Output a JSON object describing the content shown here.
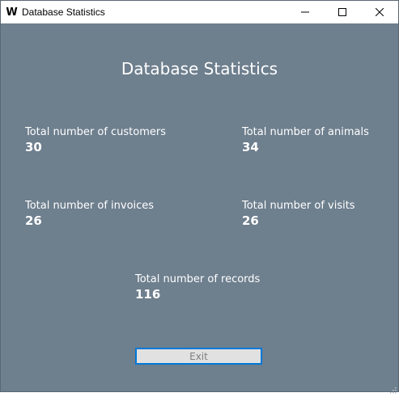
{
  "window": {
    "title": "Database Statistics",
    "app_icon_letter": "W",
    "icons": {
      "minimize": "minimize-icon",
      "maximize": "maximize-icon",
      "close": "close-icon"
    }
  },
  "main": {
    "heading": "Database Statistics",
    "stats": {
      "customers": {
        "label": "Total number of customers",
        "value": "30"
      },
      "animals": {
        "label": "Total number of animals",
        "value": "34"
      },
      "invoices": {
        "label": "Total number of invoices",
        "value": "26"
      },
      "visits": {
        "label": "Total number of visits",
        "value": "26"
      },
      "records": {
        "label": "Total number of records",
        "value": "116"
      }
    },
    "exit_label": "Exit"
  },
  "colors": {
    "background": "#6e7f8e",
    "text": "#ffffff",
    "button_face": "#e1e1e1",
    "button_border": "#0078d7"
  }
}
